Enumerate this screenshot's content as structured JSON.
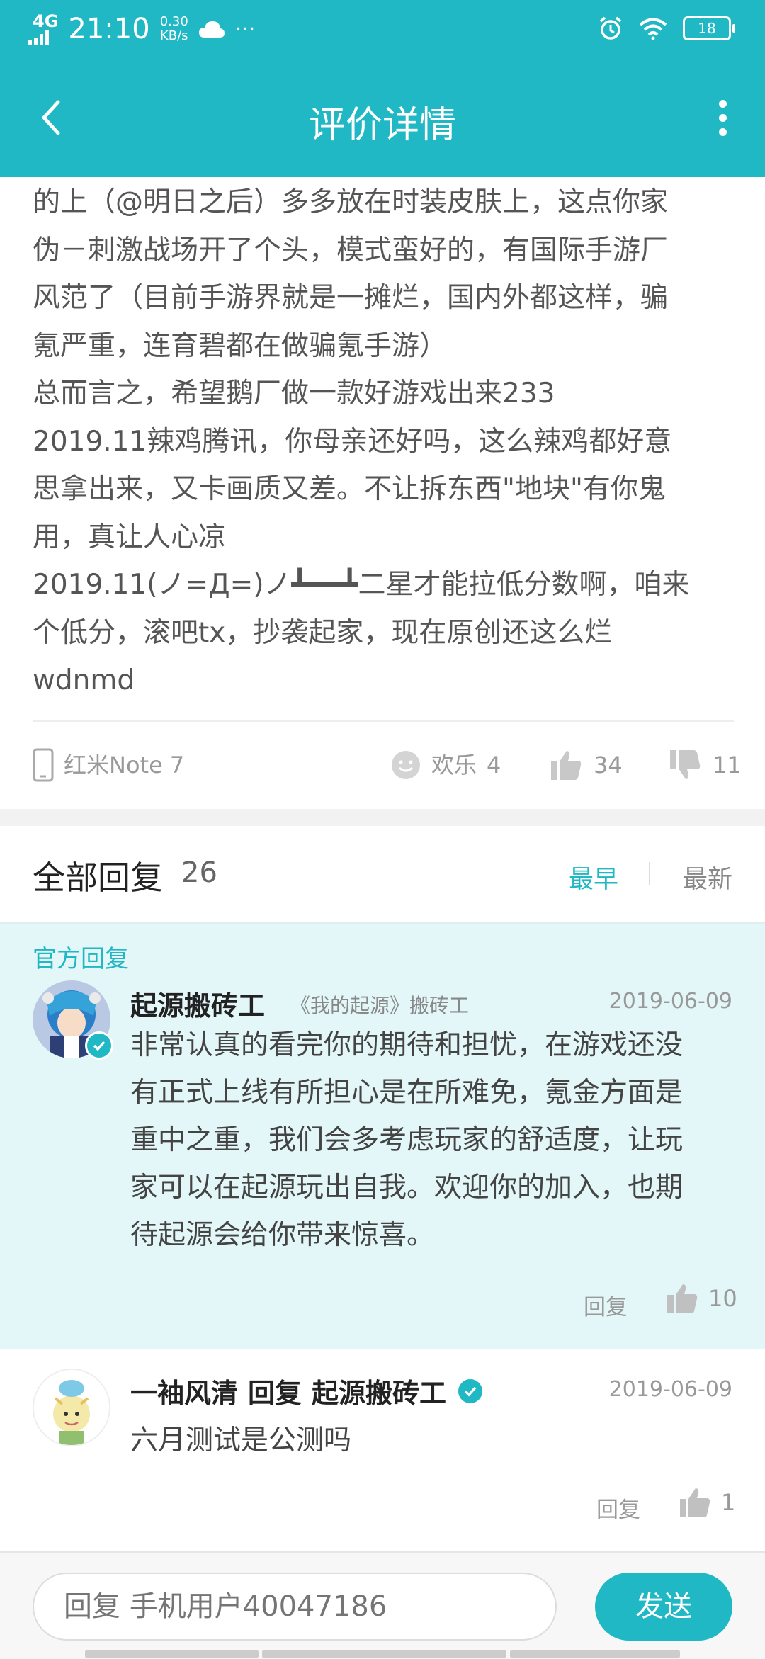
{
  "status_bar": {
    "network": "4G",
    "time": "21:10",
    "speed_value": "0.30",
    "speed_unit": "KB/s",
    "more": "···",
    "battery": "18"
  },
  "header": {
    "title": "评价详情"
  },
  "review": {
    "lines": [
      "的上（@明日之后）多多放在时装皮肤上，这点你家",
      "伪－刺激战场开了个头，模式蛮好的，有国际手游厂",
      "风范了（目前手游界就是一摊烂，国内外都这样，骗",
      "氪严重，连育碧都在做骗氪手游）",
      "总而言之，希望鹅厂做一款好游戏出来233",
      "2019.11辣鸡腾讯，你母亲还好吗，这么辣鸡都好意",
      "思拿出来，又卡画质又差。不让拆东西\"地块\"有你鬼",
      "用，真让人心凉",
      "2019.11(ノ=Д=)ノ┻━━┻二星才能拉低分数啊，咱来",
      "个低分，滚吧tx，抄袭起家，现在原创还这么烂",
      "wdnmd"
    ],
    "device": "红米Note 7",
    "mood_label": "欢乐",
    "mood_count": "4",
    "like_count": "34",
    "dislike_count": "11"
  },
  "replies_section": {
    "title": "全部回复",
    "count": "26",
    "sort_earliest": "最早",
    "sort_newest": "最新"
  },
  "official_reply": {
    "label": "官方回复",
    "author": "起源搬砖工",
    "tag": "《我的起源》搬砖工",
    "date": "2019-06-09",
    "lines": [
      "非常认真的看完你的期待和担忧，在游戏还没",
      "有正式上线有所担心是在所难免，氪金方面是",
      "重中之重，我们会多考虑玩家的舒适度，让玩",
      "家可以在起源玩出自我。欢迎你的加入，也期",
      "待起源会给你带来惊喜。"
    ],
    "reply_label": "回复",
    "like_count": "10"
  },
  "user_reply": {
    "author": "一袖风清",
    "reply_word": "回复",
    "target": "起源搬砖工",
    "date": "2019-06-09",
    "text": "六月测试是公测吗",
    "reply_label": "回复",
    "like_count": "1"
  },
  "composer": {
    "placeholder": "回复 手机用户40047186",
    "send_label": "发送"
  },
  "colors": {
    "accent": "#1fb8c4",
    "official_bg": "#e3f6f8"
  }
}
